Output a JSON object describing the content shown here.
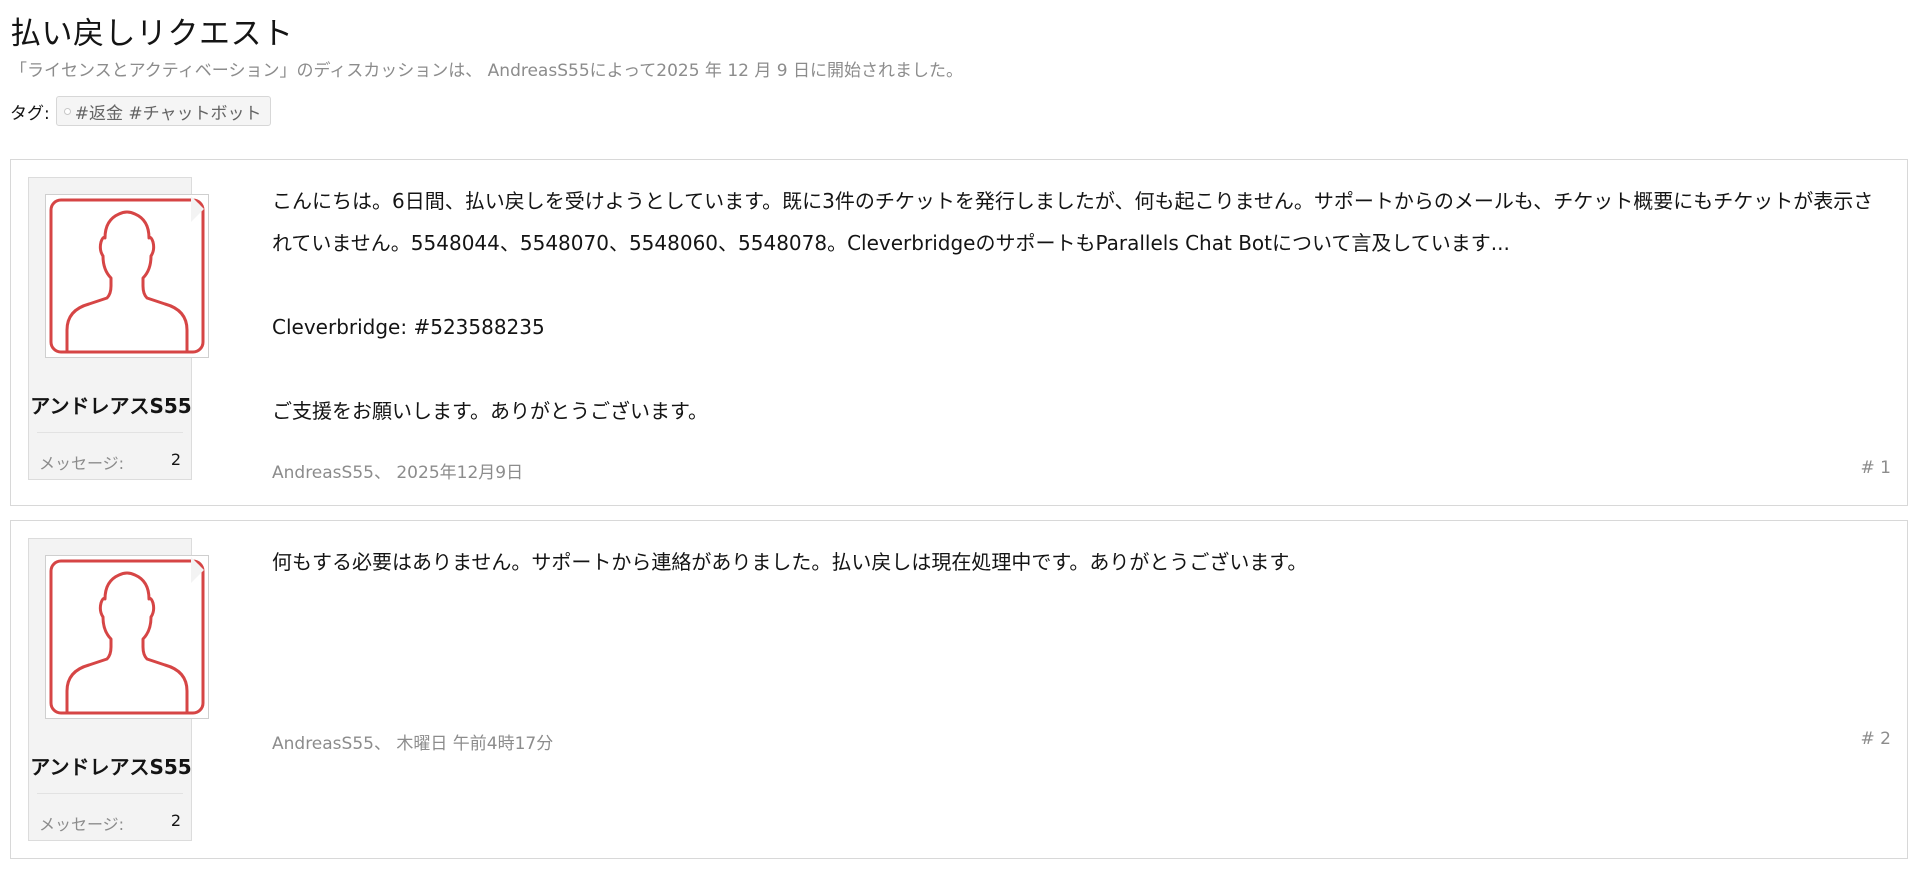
{
  "thread": {
    "title": "払い戻しリクエスト",
    "description": "「ライセンスとアクティベーション」のディスカッションは、 AndreasS55によって2025 年 12 月 9 日に開始されました。",
    "tags_label": "タグ:",
    "tags": [
      "#返金 #チャットボット"
    ]
  },
  "posts": [
    {
      "user": {
        "name": "アンドレアスS55",
        "messages_label": "メッセージ:",
        "messages": "2"
      },
      "body": [
        "こんにちは。6日間、払い戻しを受けようとしています。既に3件のチケットを発行しましたが、何も起こりません。サポートからのメールも、チケット概要にもチケットが表示されていません。5548044、5548070、5548060、5548078。CleverbridgeのサポートもParallels Chat Botについて言及しています...",
        "Cleverbridge: #523588235",
        "ご支援をお願いします。ありがとうございます。"
      ],
      "meta": "AndreasS55、 2025年12月9日",
      "number": "# 1"
    },
    {
      "user": {
        "name": "アンドレアスS55",
        "messages_label": "メッセージ:",
        "messages": "2"
      },
      "body": [
        "何もする必要はありません。サポートから連絡がありました。払い戻しは現在処理中です。ありがとうございます。"
      ],
      "meta": "AndreasS55、 木曜日 午前4時17分",
      "number": "# 2"
    }
  ],
  "colors": {
    "avatar_accent": "#d64545",
    "muted_text": "#8c8c8c",
    "border": "#d8d8d8"
  },
  "icons": {
    "avatar": "default-user-silhouette-icon",
    "tag": "tag-icon"
  }
}
